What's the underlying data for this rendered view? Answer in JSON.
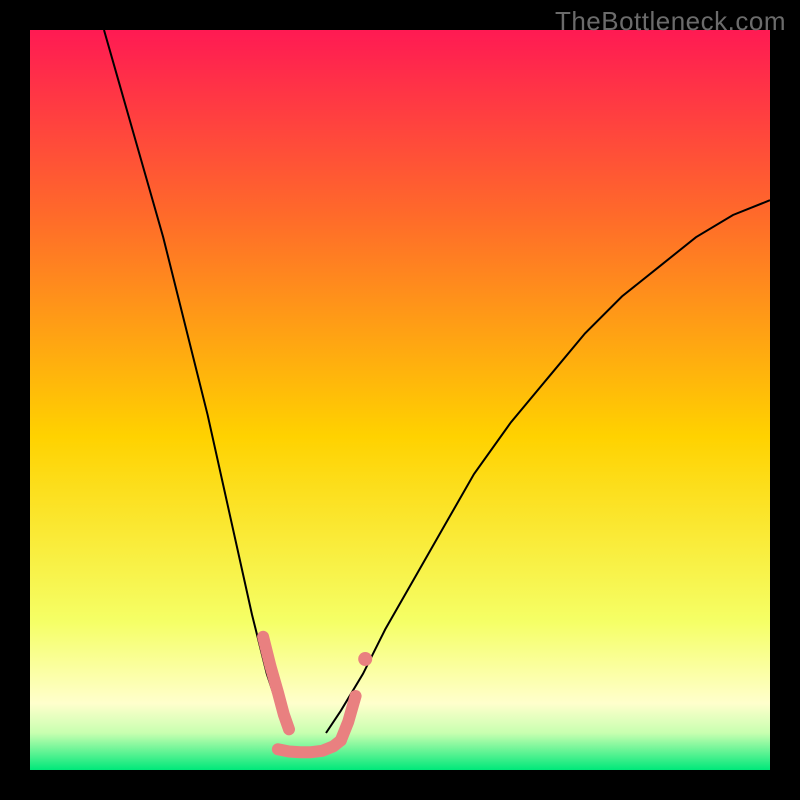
{
  "watermark": "TheBottleneck.com",
  "chart_data": {
    "type": "line",
    "title": "",
    "xlabel": "",
    "ylabel": "",
    "xlim": [
      0,
      100
    ],
    "ylim": [
      0,
      100
    ],
    "grid": false,
    "legend": false,
    "background_gradient": {
      "top_color": "#ff1a53",
      "mid_color": "#ffd200",
      "bottom_color": "#00e87a"
    },
    "series": [
      {
        "name": "curve-left",
        "stroke": "#000000",
        "stroke_width": 2,
        "x": [
          10,
          12,
          14,
          16,
          18,
          20,
          22,
          24,
          26,
          28,
          30,
          31,
          32,
          33,
          34,
          35
        ],
        "y": [
          100,
          93,
          86,
          79,
          72,
          64,
          56,
          48,
          39,
          30,
          21,
          17,
          13,
          10,
          7,
          5
        ]
      },
      {
        "name": "curve-right",
        "stroke": "#000000",
        "stroke_width": 2,
        "x": [
          40,
          42,
          45,
          48,
          52,
          56,
          60,
          65,
          70,
          75,
          80,
          85,
          90,
          95,
          100
        ],
        "y": [
          5,
          8,
          13,
          19,
          26,
          33,
          40,
          47,
          53,
          59,
          64,
          68,
          72,
          75,
          77
        ]
      },
      {
        "name": "valley-cap-left",
        "stroke": "#e98080",
        "stroke_width": 12,
        "linecap": "round",
        "x": [
          31.5,
          32.5,
          33.5,
          34.3,
          35.0
        ],
        "y": [
          18.0,
          14.0,
          10.5,
          7.5,
          5.5
        ]
      },
      {
        "name": "valley-floor",
        "stroke": "#e98080",
        "stroke_width": 12,
        "linecap": "round",
        "x": [
          33.5,
          35.0,
          36.5,
          38.0,
          39.5,
          41.0,
          42.0
        ],
        "y": [
          2.8,
          2.5,
          2.4,
          2.4,
          2.6,
          3.2,
          4.0
        ]
      },
      {
        "name": "valley-cap-right",
        "stroke": "#e98080",
        "stroke_width": 12,
        "linecap": "round",
        "x": [
          42.0,
          43.0,
          44.0
        ],
        "y": [
          4.0,
          6.5,
          10.0
        ]
      },
      {
        "name": "valley-dot-right",
        "stroke": "#e98080",
        "stroke_width": 14,
        "linecap": "round",
        "x": [
          45.3,
          45.3
        ],
        "y": [
          15.0,
          15.0
        ]
      }
    ]
  }
}
